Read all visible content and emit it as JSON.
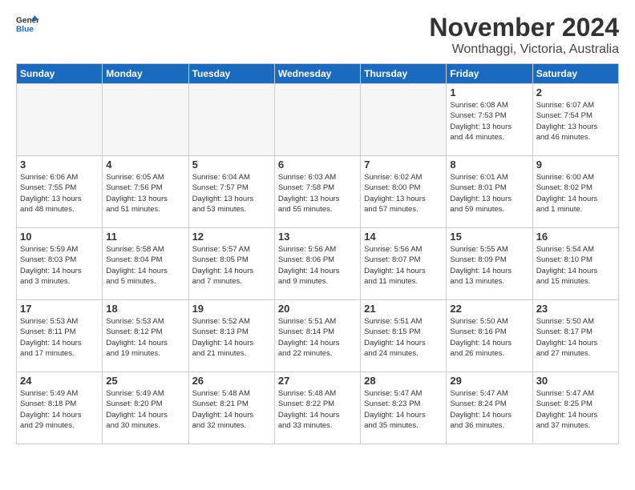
{
  "header": {
    "logo_general": "General",
    "logo_blue": "Blue",
    "month_title": "November 2024",
    "location": "Wonthaggi, Victoria, Australia"
  },
  "weekdays": [
    "Sunday",
    "Monday",
    "Tuesday",
    "Wednesday",
    "Thursday",
    "Friday",
    "Saturday"
  ],
  "weeks": [
    [
      {
        "day": "",
        "info": ""
      },
      {
        "day": "",
        "info": ""
      },
      {
        "day": "",
        "info": ""
      },
      {
        "day": "",
        "info": ""
      },
      {
        "day": "",
        "info": ""
      },
      {
        "day": "1",
        "info": "Sunrise: 6:08 AM\nSunset: 7:53 PM\nDaylight: 13 hours\nand 44 minutes."
      },
      {
        "day": "2",
        "info": "Sunrise: 6:07 AM\nSunset: 7:54 PM\nDaylight: 13 hours\nand 46 minutes."
      }
    ],
    [
      {
        "day": "3",
        "info": "Sunrise: 6:06 AM\nSunset: 7:55 PM\nDaylight: 13 hours\nand 48 minutes."
      },
      {
        "day": "4",
        "info": "Sunrise: 6:05 AM\nSunset: 7:56 PM\nDaylight: 13 hours\nand 51 minutes."
      },
      {
        "day": "5",
        "info": "Sunrise: 6:04 AM\nSunset: 7:57 PM\nDaylight: 13 hours\nand 53 minutes."
      },
      {
        "day": "6",
        "info": "Sunrise: 6:03 AM\nSunset: 7:58 PM\nDaylight: 13 hours\nand 55 minutes."
      },
      {
        "day": "7",
        "info": "Sunrise: 6:02 AM\nSunset: 8:00 PM\nDaylight: 13 hours\nand 57 minutes."
      },
      {
        "day": "8",
        "info": "Sunrise: 6:01 AM\nSunset: 8:01 PM\nDaylight: 13 hours\nand 59 minutes."
      },
      {
        "day": "9",
        "info": "Sunrise: 6:00 AM\nSunset: 8:02 PM\nDaylight: 14 hours\nand 1 minute."
      }
    ],
    [
      {
        "day": "10",
        "info": "Sunrise: 5:59 AM\nSunset: 8:03 PM\nDaylight: 14 hours\nand 3 minutes."
      },
      {
        "day": "11",
        "info": "Sunrise: 5:58 AM\nSunset: 8:04 PM\nDaylight: 14 hours\nand 5 minutes."
      },
      {
        "day": "12",
        "info": "Sunrise: 5:57 AM\nSunset: 8:05 PM\nDaylight: 14 hours\nand 7 minutes."
      },
      {
        "day": "13",
        "info": "Sunrise: 5:56 AM\nSunset: 8:06 PM\nDaylight: 14 hours\nand 9 minutes."
      },
      {
        "day": "14",
        "info": "Sunrise: 5:56 AM\nSunset: 8:07 PM\nDaylight: 14 hours\nand 11 minutes."
      },
      {
        "day": "15",
        "info": "Sunrise: 5:55 AM\nSunset: 8:09 PM\nDaylight: 14 hours\nand 13 minutes."
      },
      {
        "day": "16",
        "info": "Sunrise: 5:54 AM\nSunset: 8:10 PM\nDaylight: 14 hours\nand 15 minutes."
      }
    ],
    [
      {
        "day": "17",
        "info": "Sunrise: 5:53 AM\nSunset: 8:11 PM\nDaylight: 14 hours\nand 17 minutes."
      },
      {
        "day": "18",
        "info": "Sunrise: 5:53 AM\nSunset: 8:12 PM\nDaylight: 14 hours\nand 19 minutes."
      },
      {
        "day": "19",
        "info": "Sunrise: 5:52 AM\nSunset: 8:13 PM\nDaylight: 14 hours\nand 21 minutes."
      },
      {
        "day": "20",
        "info": "Sunrise: 5:51 AM\nSunset: 8:14 PM\nDaylight: 14 hours\nand 22 minutes."
      },
      {
        "day": "21",
        "info": "Sunrise: 5:51 AM\nSunset: 8:15 PM\nDaylight: 14 hours\nand 24 minutes."
      },
      {
        "day": "22",
        "info": "Sunrise: 5:50 AM\nSunset: 8:16 PM\nDaylight: 14 hours\nand 26 minutes."
      },
      {
        "day": "23",
        "info": "Sunrise: 5:50 AM\nSunset: 8:17 PM\nDaylight: 14 hours\nand 27 minutes."
      }
    ],
    [
      {
        "day": "24",
        "info": "Sunrise: 5:49 AM\nSunset: 8:18 PM\nDaylight: 14 hours\nand 29 minutes."
      },
      {
        "day": "25",
        "info": "Sunrise: 5:49 AM\nSunset: 8:20 PM\nDaylight: 14 hours\nand 30 minutes."
      },
      {
        "day": "26",
        "info": "Sunrise: 5:48 AM\nSunset: 8:21 PM\nDaylight: 14 hours\nand 32 minutes."
      },
      {
        "day": "27",
        "info": "Sunrise: 5:48 AM\nSunset: 8:22 PM\nDaylight: 14 hours\nand 33 minutes."
      },
      {
        "day": "28",
        "info": "Sunrise: 5:47 AM\nSunset: 8:23 PM\nDaylight: 14 hours\nand 35 minutes."
      },
      {
        "day": "29",
        "info": "Sunrise: 5:47 AM\nSunset: 8:24 PM\nDaylight: 14 hours\nand 36 minutes."
      },
      {
        "day": "30",
        "info": "Sunrise: 5:47 AM\nSunset: 8:25 PM\nDaylight: 14 hours\nand 37 minutes."
      }
    ]
  ]
}
